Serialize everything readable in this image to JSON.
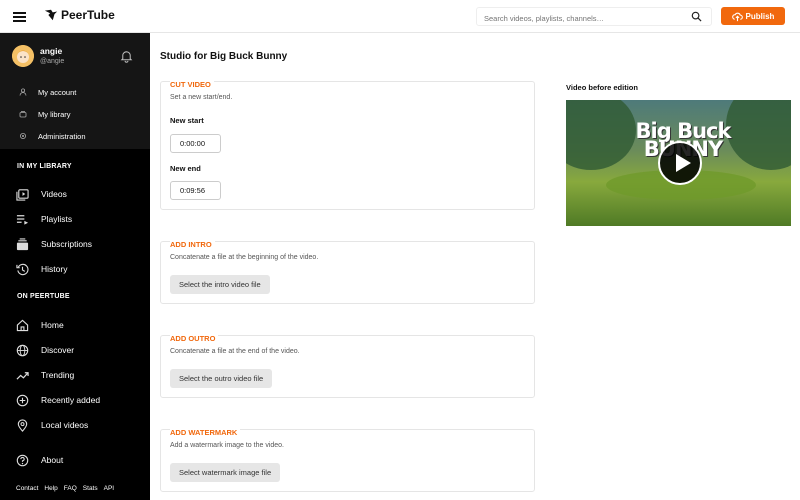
{
  "header": {
    "brand": "PeerTube",
    "search_placeholder": "Search videos, playlists, channels…",
    "publish_label": "Publish",
    "accent": "#f1680d"
  },
  "sidebar": {
    "user": {
      "name": "angie",
      "handle": "@angie"
    },
    "user_menu": [
      {
        "label": "My account",
        "icon": "user-icon"
      },
      {
        "label": "My library",
        "icon": "library-icon"
      },
      {
        "label": "Administration",
        "icon": "cog-icon"
      }
    ],
    "library_title": "IN MY LIBRARY",
    "library": [
      {
        "label": "Videos",
        "icon": "videos-icon"
      },
      {
        "label": "Playlists",
        "icon": "playlists-icon"
      },
      {
        "label": "Subscriptions",
        "icon": "subscriptions-icon"
      },
      {
        "label": "History",
        "icon": "history-icon"
      }
    ],
    "peertube_title": "ON PEERTUBE",
    "peertube": [
      {
        "label": "Home",
        "icon": "home-icon"
      },
      {
        "label": "Discover",
        "icon": "globe-icon"
      },
      {
        "label": "Trending",
        "icon": "trending-icon"
      },
      {
        "label": "Recently added",
        "icon": "plus-circle-icon"
      },
      {
        "label": "Local videos",
        "icon": "location-icon"
      }
    ],
    "about": "About",
    "footer": [
      "Contact",
      "Help",
      "FAQ",
      "Stats",
      "API"
    ]
  },
  "main": {
    "title": "Studio for Big Buck Bunny",
    "cut": {
      "title": "CUT VIDEO",
      "desc": "Set a new start/end.",
      "start_label": "New start",
      "start_value": "0:00:00",
      "end_label": "New end",
      "end_value": "0:09:56"
    },
    "intro": {
      "title": "ADD INTRO",
      "desc": "Concatenate a file at the beginning of the video.",
      "button": "Select the intro video file"
    },
    "outro": {
      "title": "ADD OUTRO",
      "desc": "Concatenate a file at the end of the video.",
      "button": "Select the outro video file"
    },
    "watermark": {
      "title": "ADD WATERMARK",
      "desc": "Add a watermark image to the video.",
      "button": "Select watermark image file"
    },
    "preview": {
      "label": "Video before edition",
      "thumb_text": "Big Buck BUNNY"
    }
  }
}
